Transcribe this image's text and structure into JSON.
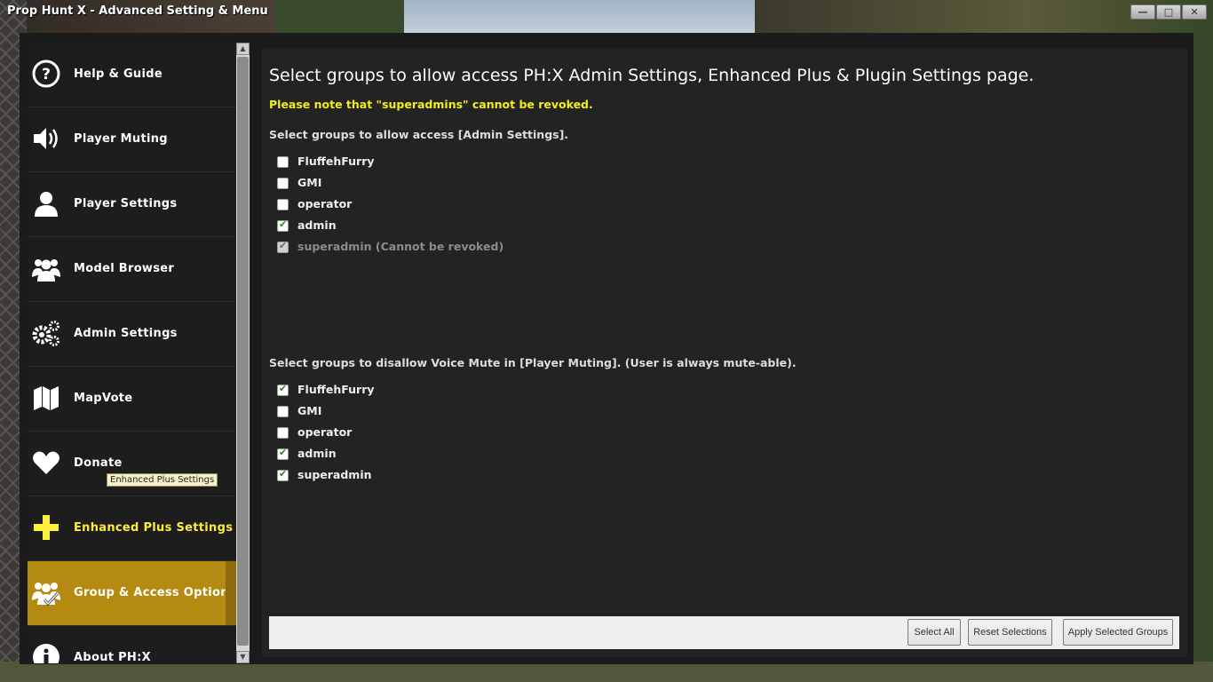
{
  "window": {
    "title": "Prop Hunt X - Advanced Setting & Menu",
    "minimize": "—",
    "maximize": "□",
    "close": "✕"
  },
  "sidebar": {
    "items": [
      {
        "label": "Help & Guide",
        "icon": "help-icon"
      },
      {
        "label": "Player Muting",
        "icon": "speaker-icon"
      },
      {
        "label": "Player Settings",
        "icon": "user-icon"
      },
      {
        "label": "Model Browser",
        "icon": "users-icon"
      },
      {
        "label": "Admin Settings",
        "icon": "gears-icon"
      },
      {
        "label": "MapVote",
        "icon": "map-icon"
      },
      {
        "label": "Donate",
        "icon": "heart-icon"
      },
      {
        "label": "Enhanced Plus Settings",
        "icon": "plus-icon"
      },
      {
        "label": "Group & Access Option",
        "icon": "group-check-icon"
      },
      {
        "label": "About PH:X",
        "icon": "info-icon"
      }
    ],
    "tooltip": "Enhanced Plus Settings"
  },
  "content": {
    "heading": "Select groups to allow access PH:X Admin Settings, Enhanced Plus & Plugin Settings page.",
    "note": "Please note that \"superadmins\" cannot be revoked.",
    "section1": {
      "title": "Select groups to allow access [Admin Settings].",
      "groups": [
        {
          "label": "FluffehFurry",
          "checked": false
        },
        {
          "label": "GMI",
          "checked": false
        },
        {
          "label": "operator",
          "checked": false
        },
        {
          "label": "admin",
          "checked": true
        },
        {
          "label": "superadmin (Cannot be revoked)",
          "checked": true,
          "disabled": true
        }
      ]
    },
    "section2": {
      "title": "Select groups to disallow Voice Mute in [Player Muting]. (User is always mute-able).",
      "groups": [
        {
          "label": "FluffehFurry",
          "checked": true
        },
        {
          "label": "GMI",
          "checked": false
        },
        {
          "label": "operator",
          "checked": false
        },
        {
          "label": "admin",
          "checked": true
        },
        {
          "label": "superadmin",
          "checked": true
        }
      ]
    },
    "footer": {
      "select_all": "Select All",
      "reset": "Reset Selections",
      "apply": "Apply Selected Groups"
    }
  },
  "colors": {
    "active_item": "#b58a10",
    "note_yellow": "#f2ee1a",
    "enhanced_label": "#ffee3b"
  }
}
